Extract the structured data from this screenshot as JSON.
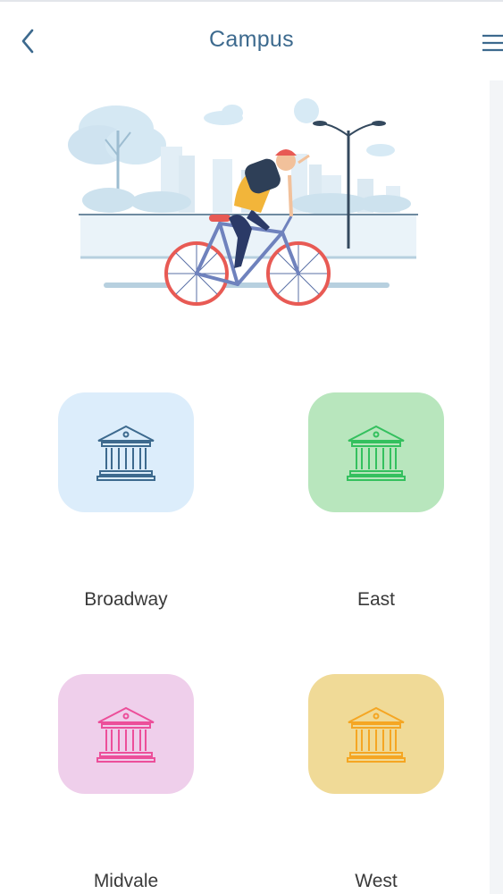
{
  "header": {
    "title": "Campus",
    "back_icon": "chevron-left-icon",
    "menu_icon": "hamburger-menu-icon"
  },
  "hero": {
    "illustration": "cyclist-city-illustration"
  },
  "campuses": [
    {
      "label": "Broadway",
      "icon": "building-columns-icon",
      "card_color": "#dcedfb",
      "icon_color": "#3d6a8e"
    },
    {
      "label": "East",
      "icon": "building-columns-icon",
      "card_color": "#b8e6bd",
      "icon_color": "#34c05e"
    },
    {
      "label": "Midvale",
      "icon": "building-columns-icon",
      "card_color": "#efcfeb",
      "icon_color": "#ec4f9a"
    },
    {
      "label": "West",
      "icon": "building-columns-icon",
      "card_color": "#f0da97",
      "icon_color": "#f5a623"
    }
  ],
  "colors": {
    "accent": "#3d6a8e"
  }
}
